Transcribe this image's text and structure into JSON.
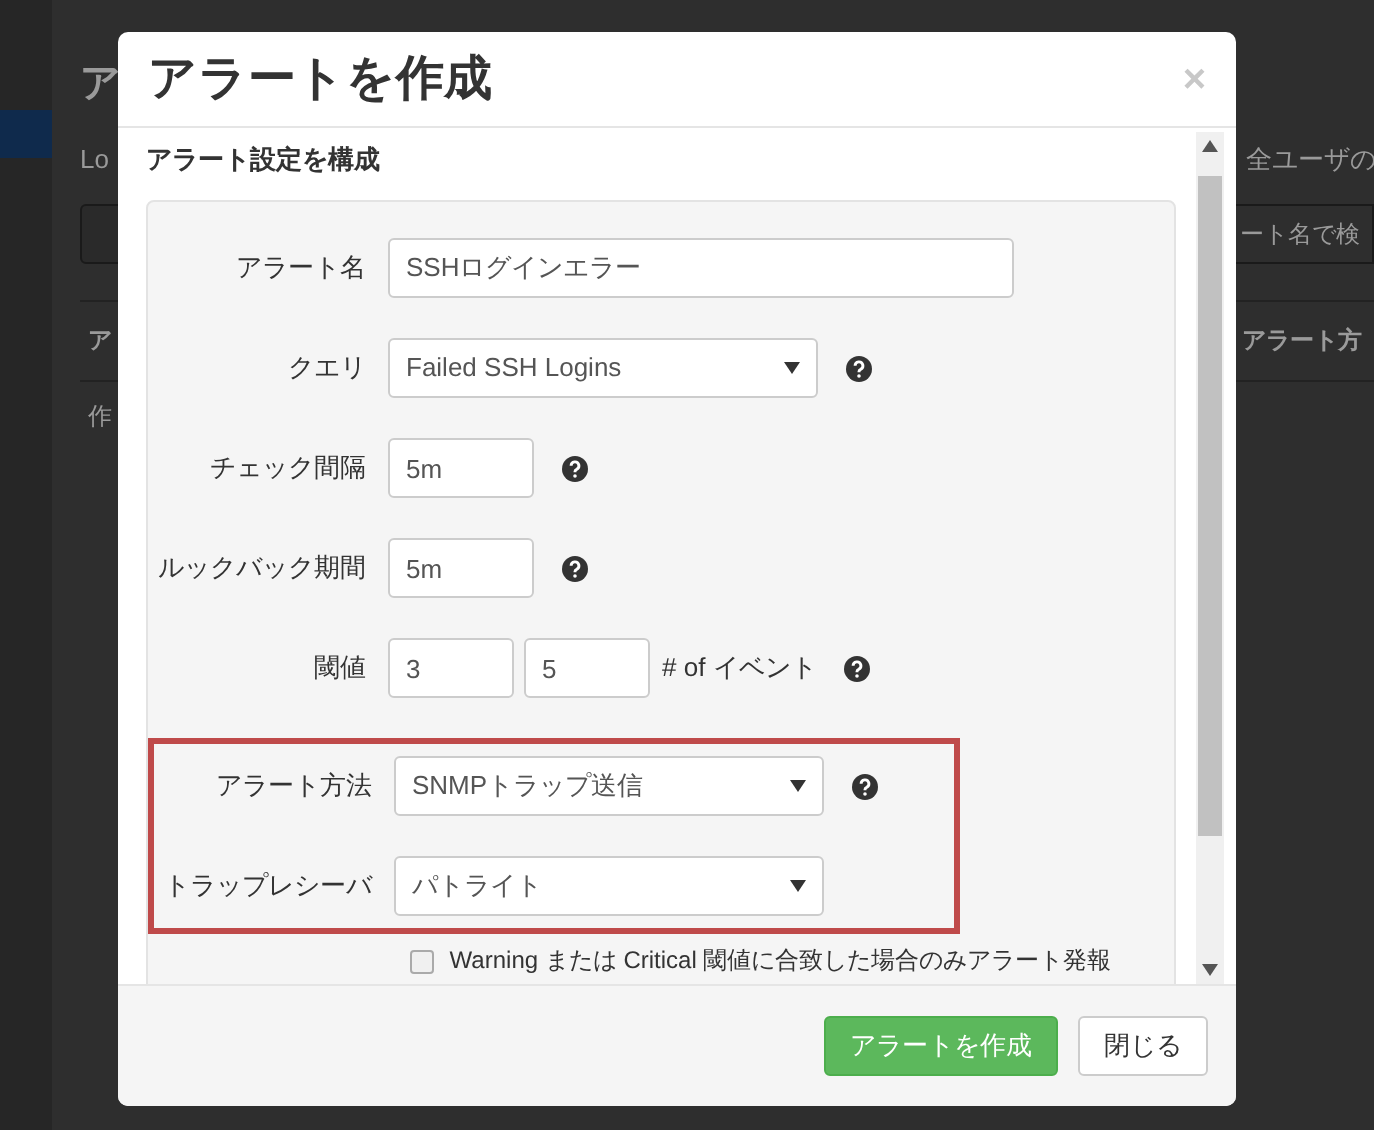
{
  "background_page": {
    "title": "ア",
    "subtitle": "Lo",
    "note": "全ユーザの",
    "search": {
      "placeholder": "ート名で検"
    },
    "table": {
      "columns": [
        "ア",
        "アラート方"
      ],
      "rows": [
        [
          "作"
        ]
      ]
    }
  },
  "dialog": {
    "title": "アラートを作成",
    "close": "×",
    "section_title": "アラート設定を構成",
    "fields": [
      {
        "kind": "wide",
        "label": "アラート名",
        "value": "SSHログインエラー",
        "help": false
      },
      {
        "kind": "select",
        "label": "クエリ",
        "value": "Failed SSH Logins",
        "help": true
      },
      {
        "kind": "short",
        "label": "チェック間隔",
        "value": "5m",
        "help": true
      },
      {
        "kind": "short",
        "label": "ルックバック期間",
        "value": "5m",
        "help": true
      },
      {
        "kind": "pair",
        "label": "閾値",
        "values": [
          "3",
          "5"
        ],
        "suffix": "# of イベント",
        "help": true
      }
    ],
    "highlighted_fields": [
      {
        "kind": "select",
        "label": "アラート方法",
        "value": "SNMPトラップ送信",
        "help": true
      },
      {
        "kind": "select",
        "label": "トラップレシーバ",
        "value": "パトライト",
        "help": false
      }
    ],
    "checkbox": {
      "label": "Warning または Critical 閾値に合致した場合のみアラート発報",
      "checked": false
    },
    "buttons": [
      {
        "label": "アラートを作成",
        "kind": "primary"
      },
      {
        "label": "閉じる",
        "kind": "default"
      }
    ]
  }
}
